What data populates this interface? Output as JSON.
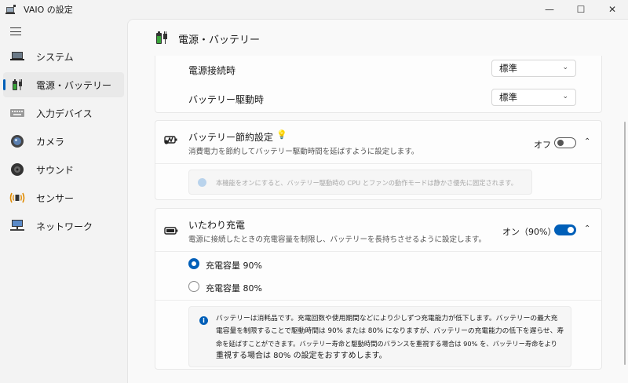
{
  "window": {
    "title": "VAIO の設定",
    "minimize": "—",
    "maximize": "☐",
    "close": "✕"
  },
  "sidebar": {
    "items": [
      {
        "label": "システム",
        "icon": "laptop-icon"
      },
      {
        "label": "電源・バッテリー",
        "icon": "battery-plug-icon"
      },
      {
        "label": "入力デバイス",
        "icon": "keyboard-icon"
      },
      {
        "label": "カメラ",
        "icon": "camera-icon"
      },
      {
        "label": "サウンド",
        "icon": "speaker-icon"
      },
      {
        "label": "センサー",
        "icon": "sensor-icon"
      },
      {
        "label": "ネットワーク",
        "icon": "network-icon"
      }
    ],
    "active_index": 1
  },
  "page": {
    "title": "電源・バッテリー"
  },
  "power_mode": {
    "ac_label": "電源接続時",
    "ac_value": "標準",
    "battery_label": "バッテリー駆動時",
    "battery_value": "標準"
  },
  "battery_saver": {
    "title": "バッテリー節約設定",
    "desc": "消費電力を節約してバッテリー駆動時間を延ばすように設定します。",
    "state": "オフ",
    "enabled": false,
    "note": "本機能をオンにすると、バッテリー駆動時の CPU とファンの動作モードは静かさ優先に固定されます。"
  },
  "care_charge": {
    "title": "いたわり充電",
    "desc": "電源に接続したときの充電容量を制限し、バッテリーを長持ちさせるように設定します。",
    "state": "オン（90%）",
    "enabled": true,
    "options": [
      {
        "label": "充電容量 90%",
        "checked": true
      },
      {
        "label": "充電容量 80%",
        "checked": false
      }
    ],
    "info_lines": [
      "バッテリーは消耗品です。充電回数や使用期間などにより少しずつ充電能力が低下します。バッテリーの最大充",
      "電容量を制限することで駆動時間は 90% または 80% になりますが、バッテリーの充電能力の低下を遅らせ、寿",
      "命を延ばすことができます。バッテリー寿命と駆動時間のバランスを重視する場合は 90% を、バッテリー寿命をより",
      "重視する場合は 80% の設定をおすすめします。"
    ]
  },
  "colors": {
    "accent": "#005fb8",
    "green_battery": "#3aa53a"
  }
}
